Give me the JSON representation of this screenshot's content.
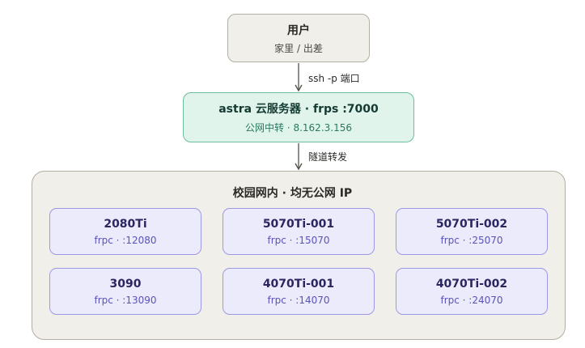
{
  "user": {
    "title": "用户",
    "subtitle": "家里 / 出差"
  },
  "edge1": {
    "label": "ssh -p 端口"
  },
  "server": {
    "title": "astra 云服务器 · frps :7000",
    "subtitle": "公网中转 · 8.162.3.156"
  },
  "edge2": {
    "label": "隧道转发"
  },
  "campus": {
    "title": "校园网内 · 均无公网 IP",
    "gpus": [
      {
        "name": "2080Ti",
        "port": "frpc · :12080"
      },
      {
        "name": "5070Ti-001",
        "port": "frpc · :15070"
      },
      {
        "name": "5070Ti-002",
        "port": "frpc · :25070"
      },
      {
        "name": "3090",
        "port": "frpc · :13090"
      },
      {
        "name": "4070Ti-001",
        "port": "frpc · :14070"
      },
      {
        "name": "4070Ti-002",
        "port": "frpc · :24070"
      }
    ]
  }
}
